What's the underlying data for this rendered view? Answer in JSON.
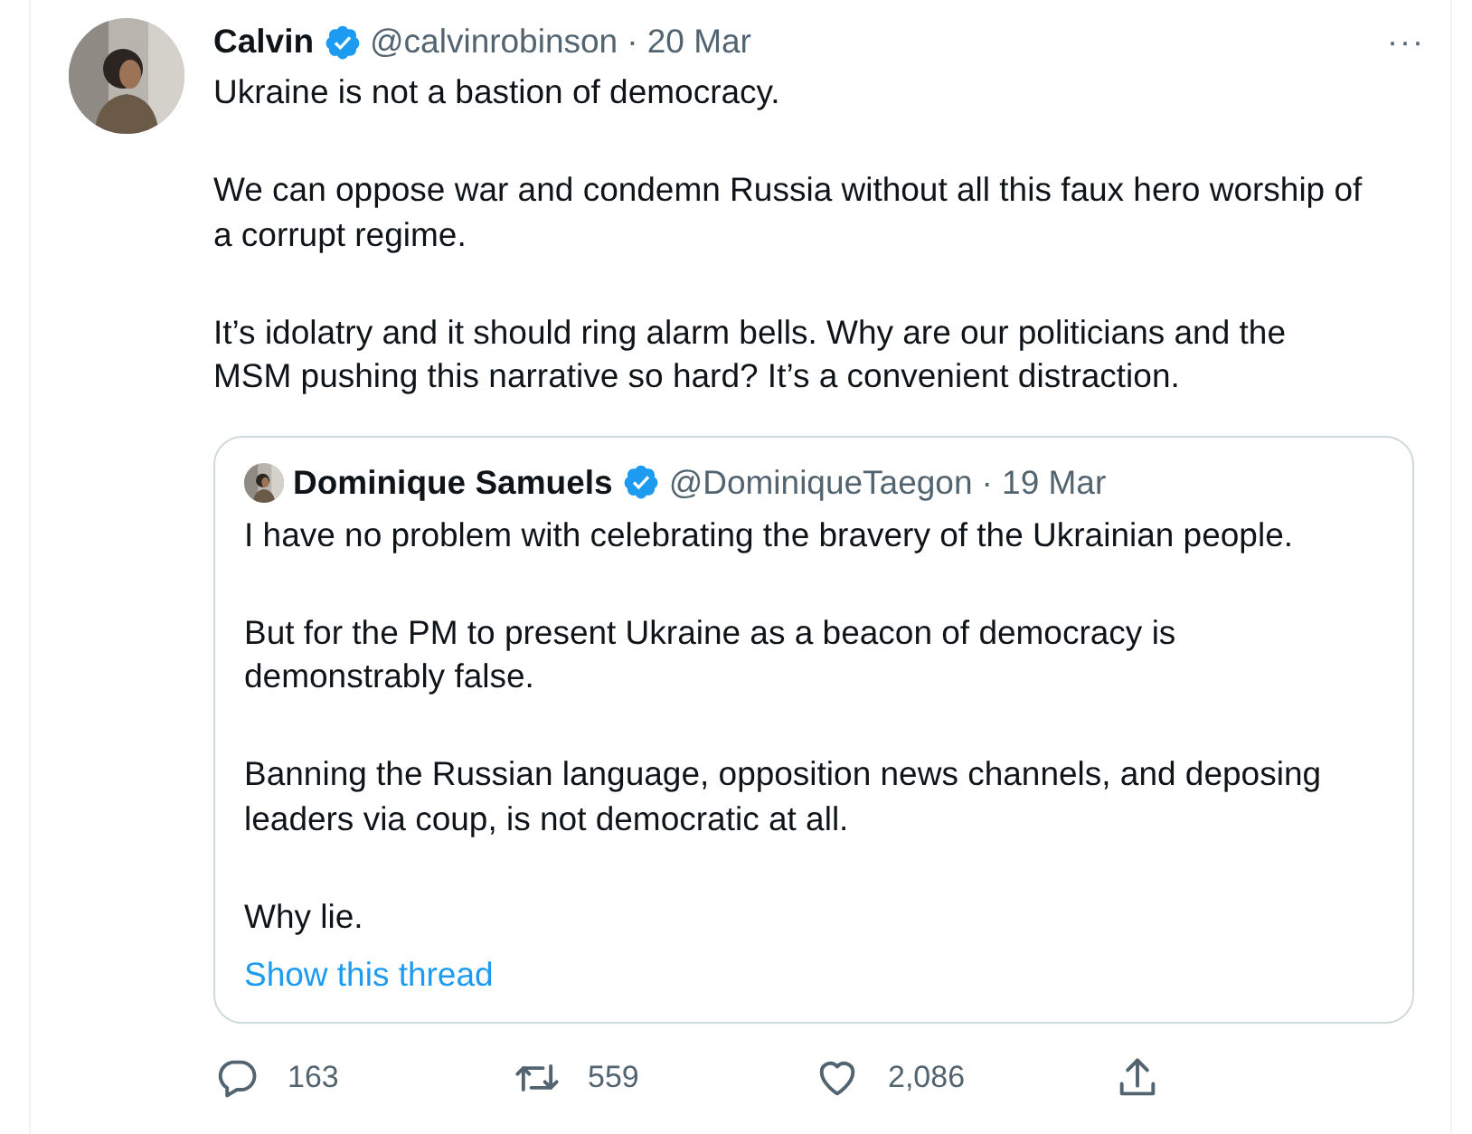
{
  "tweet": {
    "author": {
      "name": "Calvin",
      "verified": true,
      "handle": "@calvinrobinson",
      "date": "· 20 Mar"
    },
    "more": "···",
    "paragraphs": [
      "Ukraine is not a bastion of democracy.",
      "We can oppose war and condemn Russia without all this faux hero worship of a corrupt regime.",
      "It’s idolatry and it should ring alarm bells. Why are our politicians and the MSM pushing this narrative so hard? It’s a convenient distraction."
    ],
    "quote": {
      "author": {
        "name": "Dominique Samuels",
        "verified": true,
        "handle": "@DominiqueTaegon",
        "date": "· 19 Mar"
      },
      "paragraphs": [
        "I have no problem with celebrating the bravery of the Ukrainian people.",
        "But for the PM to present Ukraine as a beacon of democracy is demonstrably false.",
        "Banning the Russian language, opposition news channels, and deposing leaders via coup, is not democratic at all.",
        "Why lie."
      ],
      "link": "Show this thread"
    },
    "actions": [
      {
        "kind": "reply",
        "count": "163"
      },
      {
        "kind": "retweet",
        "count": "559"
      },
      {
        "kind": "like",
        "count": "2,086"
      },
      {
        "kind": "share"
      }
    ]
  }
}
